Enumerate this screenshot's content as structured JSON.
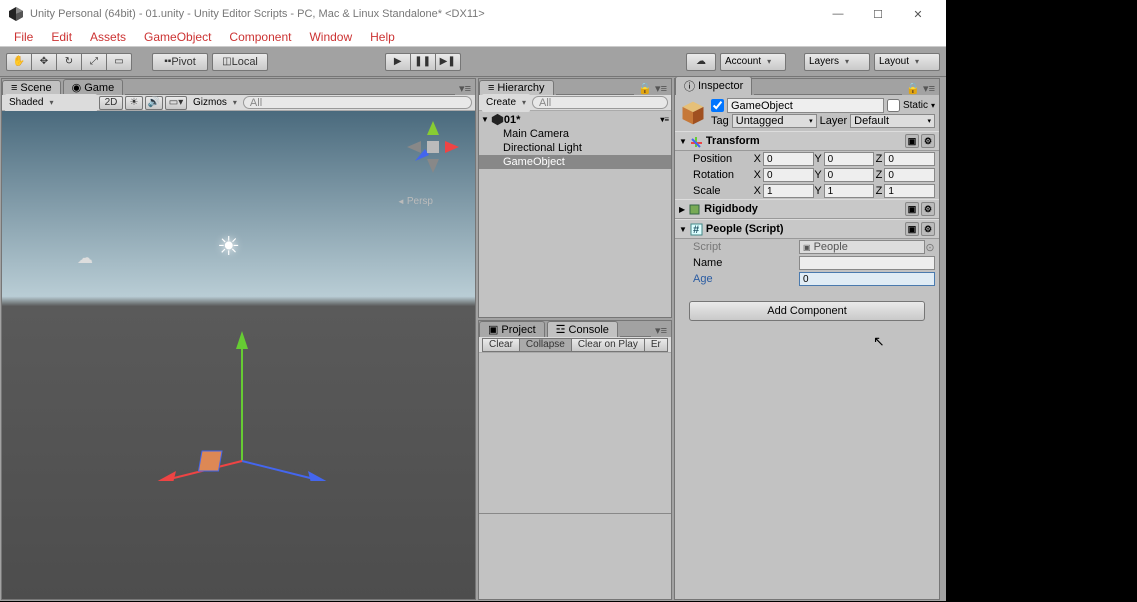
{
  "window": {
    "title": "Unity Personal (64bit) - 01.unity - Unity Editor Scripts - PC, Mac & Linux Standalone* <DX11>"
  },
  "menu": {
    "file": "File",
    "edit": "Edit",
    "assets": "Assets",
    "gameobject": "GameObject",
    "component": "Component",
    "window": "Window",
    "help": "Help"
  },
  "toolbar": {
    "pivot": "Pivot",
    "local": "Local",
    "account": "Account",
    "layers": "Layers",
    "layout": "Layout"
  },
  "scene": {
    "tab_scene": "Scene",
    "tab_game": "Game",
    "shaded": "Shaded",
    "twod": "2D",
    "gizmos": "Gizmos",
    "search_ph": "All",
    "persp": "Persp"
  },
  "hierarchy": {
    "tab": "Hierarchy",
    "create": "Create",
    "search_ph": "All",
    "scene_name": "01*",
    "items": [
      {
        "name": "Main Camera",
        "selected": false
      },
      {
        "name": "Directional Light",
        "selected": false
      },
      {
        "name": "GameObject",
        "selected": true
      }
    ]
  },
  "project": {
    "tab_project": "Project",
    "tab_console": "Console",
    "clear": "Clear",
    "collapse": "Collapse",
    "clearplay": "Clear on Play",
    "errpause": "Er"
  },
  "inspector": {
    "tab": "Inspector",
    "static": "Static",
    "enabled": true,
    "name": "GameObject",
    "tag_label": "Tag",
    "tag_value": "Untagged",
    "layer_label": "Layer",
    "layer_value": "Default",
    "transform": {
      "title": "Transform",
      "position": {
        "label": "Position",
        "x": "0",
        "y": "0",
        "z": "0"
      },
      "rotation": {
        "label": "Rotation",
        "x": "0",
        "y": "0",
        "z": "0"
      },
      "scale": {
        "label": "Scale",
        "x": "1",
        "y": "1",
        "z": "1"
      }
    },
    "rigidbody": {
      "title": "Rigidbody"
    },
    "people": {
      "title": "People (Script)",
      "script_label": "Script",
      "script_value": "People",
      "name_label": "Name",
      "name_value": "",
      "age_label": "Age",
      "age_value": "0"
    },
    "add_component": "Add Component"
  }
}
